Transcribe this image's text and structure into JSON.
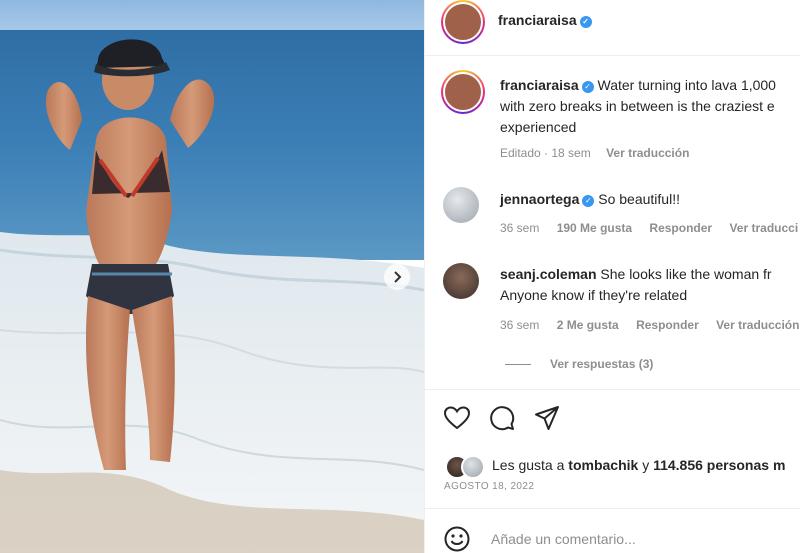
{
  "post": {
    "author": "franciaraisa",
    "caption_author": "franciaraisa",
    "caption_line1": "Water turning into lava 1,000",
    "caption_line2": "with zero breaks in between is the craziest e",
    "caption_line3": "experienced",
    "caption_meta": "Editado · 18 sem",
    "see_translation": "Ver traducción"
  },
  "comments": [
    {
      "user": "jennaortega",
      "verified": true,
      "text": "So beautiful!!",
      "age": "36 sem",
      "likes": "190 Me gusta",
      "reply": "Responder",
      "translate": "Ver traducci"
    },
    {
      "user": "seanj.coleman",
      "verified": false,
      "text_line1": "She looks like the woman fr",
      "text_line2": "Anyone know if they're related",
      "age": "36 sem",
      "likes": "2 Me gusta",
      "reply": "Responder",
      "translate": "Ver traducción",
      "view_replies": "Ver respuestas (3)"
    }
  ],
  "likes": {
    "prefix": "Les gusta a",
    "user": "tombachik",
    "connector": "y",
    "count": "114.856 personas m"
  },
  "date": "AGOSTO 18, 2022",
  "comment_box": {
    "placeholder": "Añade un comentario..."
  },
  "icons": {
    "like": "heart-icon",
    "comment": "comment-bubble-icon",
    "share": "send-icon",
    "emoji": "emoji-icon",
    "next": "chevron-right-icon",
    "verified": "verified-badge-icon"
  },
  "colors": {
    "verified": "#3897f0",
    "muted": "#8e8e8e",
    "text": "#262626"
  }
}
